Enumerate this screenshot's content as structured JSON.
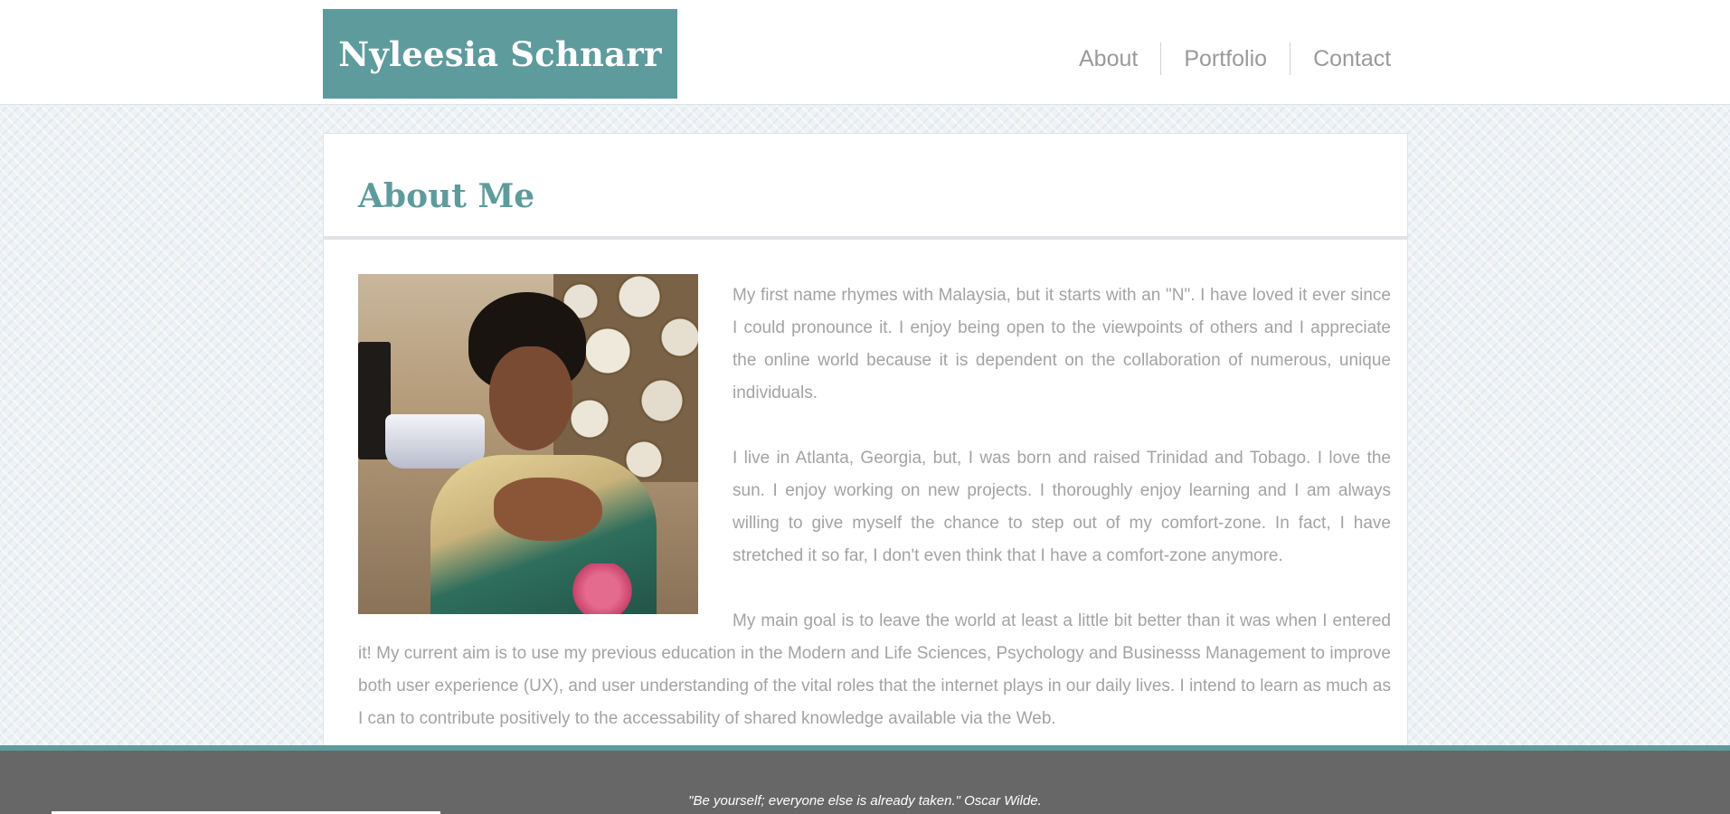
{
  "header": {
    "site_title": "Nyleesia Schnarr",
    "nav": [
      "About",
      "Portfolio",
      "Contact"
    ]
  },
  "main": {
    "title": "About Me",
    "paragraphs": [
      "My first name rhymes with Malaysia, but it starts with an \"N\". I have loved it ever since I could pronounce it. I enjoy being open to the viewpoints of others and I appreciate the online world because it is dependent on the collaboration of numerous, unique individuals.",
      "I live in Atlanta, Georgia, but, I was born and raised Trinidad and Tobago. I love the sun. I enjoy working on new projects. I thoroughly enjoy learning and I am always willing to give myself the chance to step out of my comfort-zone. In fact, I have stretched it so far, I don't even think that I have a comfort-zone anymore.",
      "My main goal is to leave the world at least a little bit better than it was when I entered it! My current aim is to use my previous education in the Modern and Life Sciences, Psychology and Businesss Management to improve both user experience (UX), and user understanding of the vital roles that the internet plays in our daily lives. I intend to learn as much as I can to contribute positively to the accessability of shared knowledge available via the Web."
    ]
  },
  "footer": {
    "quote": "\"Be yourself; everyone else is already taken.\" Oscar Wilde."
  },
  "colors": {
    "accent": "#5e9b9d",
    "text_muted": "#a3a3a3",
    "footer_bg": "#676767"
  }
}
